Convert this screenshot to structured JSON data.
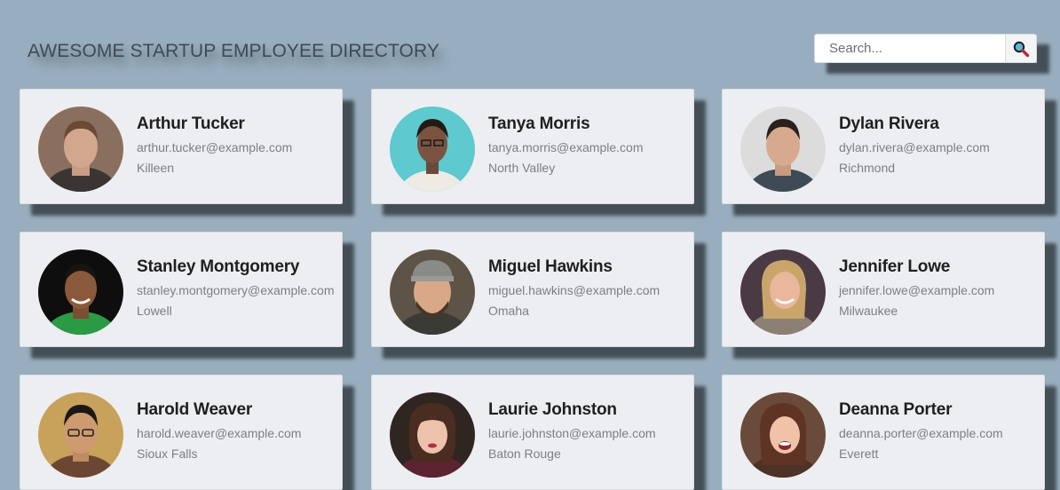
{
  "header": {
    "title": "AWESOME STARTUP EMPLOYEE DIRECTORY"
  },
  "search": {
    "placeholder": "Search...",
    "button_icon": "magnifier-icon"
  },
  "employees": [
    {
      "name": "Arthur Tucker",
      "email": "arthur.tucker@example.com",
      "city": "Killeen"
    },
    {
      "name": "Tanya Morris",
      "email": "tanya.morris@example.com",
      "city": "North Valley"
    },
    {
      "name": "Dylan Rivera",
      "email": "dylan.rivera@example.com",
      "city": "Richmond"
    },
    {
      "name": "Stanley Montgomery",
      "email": "stanley.montgomery@example.com",
      "city": "Lowell"
    },
    {
      "name": "Miguel Hawkins",
      "email": "miguel.hawkins@example.com",
      "city": "Omaha"
    },
    {
      "name": "Jennifer Lowe",
      "email": "jennifer.lowe@example.com",
      "city": "Milwaukee"
    },
    {
      "name": "Harold Weaver",
      "email": "harold.weaver@example.com",
      "city": "Sioux Falls"
    },
    {
      "name": "Laurie Johnston",
      "email": "laurie.johnston@example.com",
      "city": "Baton Rouge"
    },
    {
      "name": "Deanna Porter",
      "email": "deanna.porter@example.com",
      "city": "Everett"
    }
  ]
}
